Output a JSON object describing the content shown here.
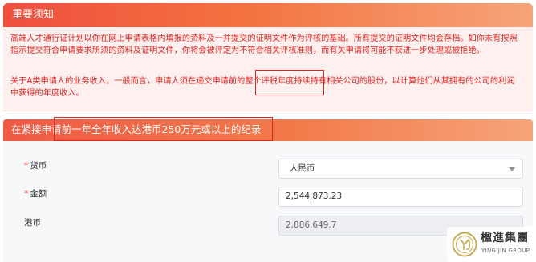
{
  "notice": {
    "title": "重要须知",
    "paragraph1": "高端人才通行证计划以你在网上申请表格内填报的资料及一并提交的证明文件作为评核的基础。所有提交的证明文件均会存档。如你未有按照指示提交符合申请要求所须的资料及证明文件，你将会被评定为不符合相关评核准则，而有关申请将可能不获进一步处理或被拒绝。",
    "paragraph2": "关于A类申请人的业务收入，一般而言，申请人须在递交申请前的整个评税年度持续持有相关公司的股份，以计算他们从其拥有的公司的利润中获得的年度收入。"
  },
  "section": {
    "title": "在紧接申请前一年全年收入达港币250万元或以上的纪录"
  },
  "form": {
    "currency_label": "货币",
    "currency_value": "人民币",
    "amount_label": "金额",
    "amount_value": "2,544,873.23",
    "hkd_label": "港币",
    "hkd_value": "2,886,649.7",
    "required_mark": "*"
  },
  "watermark": {
    "name_cn": "楹進集團",
    "name_en": "YING JIN GROUP",
    "logo_icon": "yj-logo-icon"
  },
  "colors": {
    "accent_red": "#e8221c",
    "header_gradient_start": "#ef4f3f",
    "header_gradient_end": "#f6a47a",
    "notice_bg": "#fdf0ee"
  }
}
